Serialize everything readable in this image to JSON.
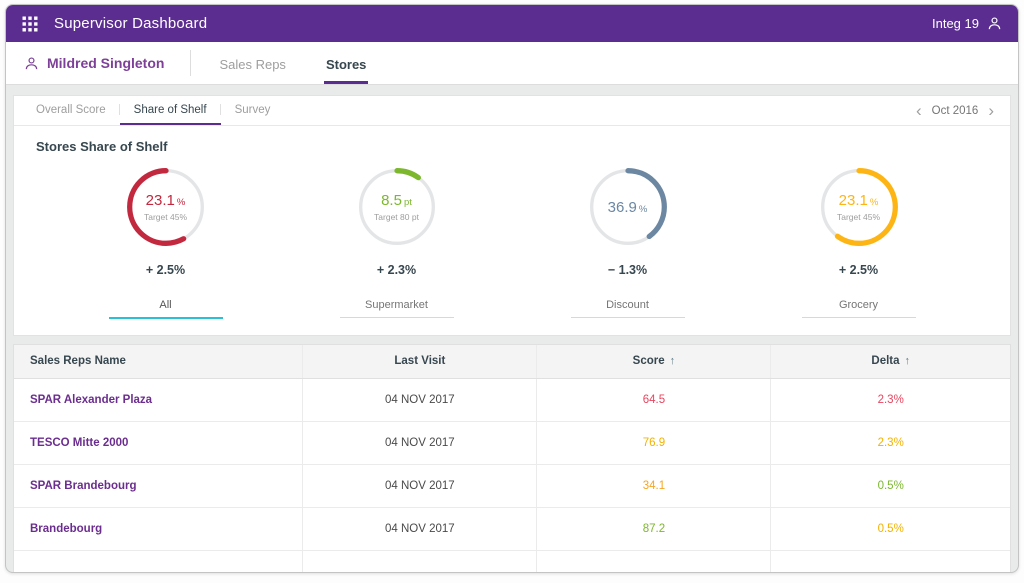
{
  "header": {
    "title": "Supervisor Dashboard",
    "user": "Integ 19"
  },
  "subheader": {
    "supervisor": "Mildred Singleton",
    "tabs": [
      {
        "label": "Sales Reps",
        "active": false
      },
      {
        "label": "Stores",
        "active": true
      }
    ]
  },
  "panel": {
    "tabs": [
      {
        "label": "Overall Score",
        "active": false
      },
      {
        "label": "Share of Shelf",
        "active": true
      },
      {
        "label": "Survey",
        "active": false
      }
    ],
    "date": "Oct 2016",
    "prev_icon": "‹",
    "next_icon": "›",
    "section_title": "Stores Share of Shelf"
  },
  "chart_data": {
    "type": "donut-gauge",
    "title": "Stores Share of Shelf",
    "gauges": [
      {
        "value": "23.1",
        "unit": "%",
        "target": "Target 45%",
        "delta": "+ 2.5%",
        "category": "All",
        "color": "#c2283e",
        "fraction": 0.58,
        "direction": "ccw",
        "active": true
      },
      {
        "value": "8.5",
        "unit": "pt",
        "target": "Target 80 pt",
        "delta": "+ 2.3%",
        "category": "Supermarket",
        "color": "#7cb72e",
        "fraction": 0.1,
        "direction": "cw",
        "active": false
      },
      {
        "value": "36.9",
        "unit": "%",
        "target": "",
        "delta": "− 1.3%",
        "category": "Discount",
        "color": "#6b87a2",
        "fraction": 0.4,
        "direction": "cw",
        "active": false
      },
      {
        "value": "23.1",
        "unit": "%",
        "target": "Target 45%",
        "delta": "+ 2.5%",
        "category": "Grocery",
        "color": "#fdb515",
        "fraction": 0.6,
        "direction": "cw",
        "active": false
      }
    ],
    "accent_active_tab": "#29c1d6"
  },
  "table": {
    "headers": [
      {
        "label": "Sales Reps Name"
      },
      {
        "label": "Last Visit"
      },
      {
        "label": "Score"
      },
      {
        "label": "Delta"
      }
    ],
    "sort_icon": "↑",
    "rows": [
      {
        "name": "SPAR Alexander Plaza",
        "last_visit": "04 NOV 2017",
        "score": "64.5",
        "score_color": "#e8455f",
        "delta": "2.3%",
        "delta_color": "#e8455f"
      },
      {
        "name": "TESCO Mitte 2000",
        "last_visit": "04 NOV 2017",
        "score": "76.9",
        "score_color": "#f3b200",
        "delta": "2.3%",
        "delta_color": "#f3b200"
      },
      {
        "name": "SPAR Brandebourg",
        "last_visit": "04 NOV 2017",
        "score": "34.1",
        "score_color": "#f5a623",
        "delta": "0.5%",
        "delta_color": "#7cb72e"
      },
      {
        "name": "Brandebourg",
        "last_visit": "04 NOV 2017",
        "score": "87.2",
        "score_color": "#7cb72e",
        "delta": "0.5%",
        "delta_color": "#f3b200"
      }
    ]
  }
}
